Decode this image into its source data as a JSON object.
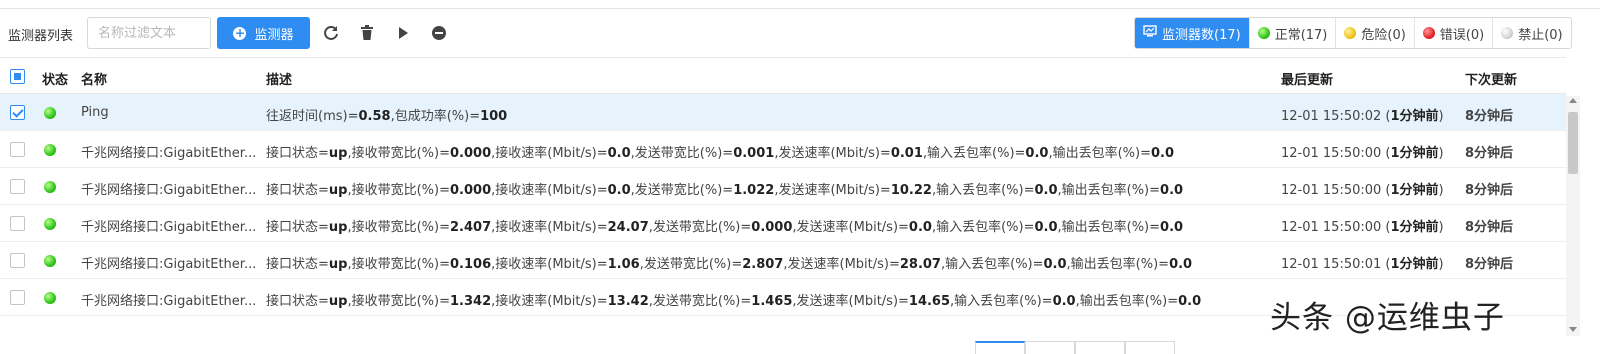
{
  "toolbar": {
    "title": "监测器列表",
    "filter_placeholder": "名称过滤文本",
    "add_label": "监测器"
  },
  "stats": [
    {
      "label": "监测器数(17)",
      "icon": "monitor-icon",
      "active": true
    },
    {
      "label": "正常(17)",
      "icon": "green-dot"
    },
    {
      "label": "危险(0)",
      "icon": "yellow-dot"
    },
    {
      "label": "错误(0)",
      "icon": "red-dot"
    },
    {
      "label": "禁止(0)",
      "icon": "gray-dot"
    }
  ],
  "columns": {
    "status": "状态",
    "name": "名称",
    "desc": "描述",
    "updated": "最后更新",
    "next": "下次更新"
  },
  "rows": [
    {
      "selected": true,
      "name": "Ping",
      "desc": [
        [
          "往返时间(ms)=",
          false
        ],
        [
          "0.58",
          true
        ],
        [
          ",包成功率(%)=",
          false
        ],
        [
          "100",
          true
        ]
      ],
      "updated": "12-01 15:50:02 (",
      "updated_rel": "1分钟前",
      "updated_end": ")",
      "next": "8分钟后"
    },
    {
      "name": "千兆网络接口:GigabitEther...",
      "desc": [
        [
          "接口状态=",
          false
        ],
        [
          "up",
          true
        ],
        [
          ",接收带宽比(%)=",
          false
        ],
        [
          "0.000",
          true
        ],
        [
          ",接收速率(Mbit/s)=",
          false
        ],
        [
          "0.0",
          true
        ],
        [
          ",发送带宽比(%)=",
          false
        ],
        [
          "0.001",
          true
        ],
        [
          ",发送速率(Mbit/s)=",
          false
        ],
        [
          "0.01",
          true
        ],
        [
          ",输入丢包率(%)=",
          false
        ],
        [
          "0.0",
          true
        ],
        [
          ",输出丢包率(%)=",
          false
        ],
        [
          "0.0",
          true
        ]
      ],
      "updated": "12-01 15:50:00 (",
      "updated_rel": "1分钟前",
      "updated_end": ")",
      "next": "8分钟后"
    },
    {
      "name": "千兆网络接口:GigabitEther...",
      "desc": [
        [
          "接口状态=",
          false
        ],
        [
          "up",
          true
        ],
        [
          ",接收带宽比(%)=",
          false
        ],
        [
          "0.000",
          true
        ],
        [
          ",接收速率(Mbit/s)=",
          false
        ],
        [
          "0.0",
          true
        ],
        [
          ",发送带宽比(%)=",
          false
        ],
        [
          "1.022",
          true
        ],
        [
          ",发送速率(Mbit/s)=",
          false
        ],
        [
          "10.22",
          true
        ],
        [
          ",输入丢包率(%)=",
          false
        ],
        [
          "0.0",
          true
        ],
        [
          ",输出丢包率(%)=",
          false
        ],
        [
          "0.0",
          true
        ]
      ],
      "updated": "12-01 15:50:00 (",
      "updated_rel": "1分钟前",
      "updated_end": ")",
      "next": "8分钟后"
    },
    {
      "name": "千兆网络接口:GigabitEther...",
      "desc": [
        [
          "接口状态=",
          false
        ],
        [
          "up",
          true
        ],
        [
          ",接收带宽比(%)=",
          false
        ],
        [
          "2.407",
          true
        ],
        [
          ",接收速率(Mbit/s)=",
          false
        ],
        [
          "24.07",
          true
        ],
        [
          ",发送带宽比(%)=",
          false
        ],
        [
          "0.000",
          true
        ],
        [
          ",发送速率(Mbit/s)=",
          false
        ],
        [
          "0.0",
          true
        ],
        [
          ",输入丢包率(%)=",
          false
        ],
        [
          "0.0",
          true
        ],
        [
          ",输出丢包率(%)=",
          false
        ],
        [
          "0.0",
          true
        ]
      ],
      "updated": "12-01 15:50:00 (",
      "updated_rel": "1分钟前",
      "updated_end": ")",
      "next": "8分钟后"
    },
    {
      "name": "千兆网络接口:GigabitEther...",
      "desc": [
        [
          "接口状态=",
          false
        ],
        [
          "up",
          true
        ],
        [
          ",接收带宽比(%)=",
          false
        ],
        [
          "0.106",
          true
        ],
        [
          ",接收速率(Mbit/s)=",
          false
        ],
        [
          "1.06",
          true
        ],
        [
          ",发送带宽比(%)=",
          false
        ],
        [
          "2.807",
          true
        ],
        [
          ",发送速率(Mbit/s)=",
          false
        ],
        [
          "28.07",
          true
        ],
        [
          ",输入丢包率(%)=",
          false
        ],
        [
          "0.0",
          true
        ],
        [
          ",输出丢包率(%)=",
          false
        ],
        [
          "0.0",
          true
        ]
      ],
      "updated": "12-01 15:50:01 (",
      "updated_rel": "1分钟前",
      "updated_end": ")",
      "next": "8分钟后"
    },
    {
      "name": "千兆网络接口:GigabitEther...",
      "desc": [
        [
          "接口状态=",
          false
        ],
        [
          "up",
          true
        ],
        [
          ",接收带宽比(%)=",
          false
        ],
        [
          "1.342",
          true
        ],
        [
          ",接收速率(Mbit/s)=",
          false
        ],
        [
          "13.42",
          true
        ],
        [
          ",发送带宽比(%)=",
          false
        ],
        [
          "1.465",
          true
        ],
        [
          ",发送速率(Mbit/s)=",
          false
        ],
        [
          "14.65",
          true
        ],
        [
          ",输入丢包率(%)=",
          false
        ],
        [
          "0.0",
          true
        ],
        [
          ",输出丢包率(%)=",
          false
        ],
        [
          "0.0",
          true
        ]
      ],
      "updated": "",
      "updated_rel": "",
      "updated_end": "",
      "next": ""
    }
  ],
  "watermark": "头条 @运维虫子",
  "colors": {
    "accent": "#2f8cf0",
    "selected_row": "#e6f3fc"
  }
}
